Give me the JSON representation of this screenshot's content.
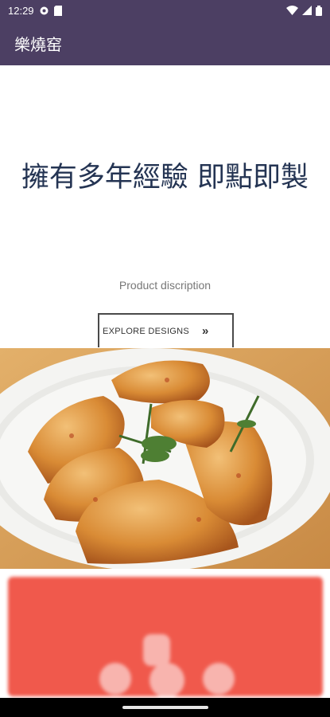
{
  "status_bar": {
    "time": "12:29",
    "icons": [
      "gear-icon",
      "sim-card-icon",
      "wifi-icon",
      "signal-icon",
      "battery-icon"
    ]
  },
  "app_bar": {
    "title": "樂燒窑"
  },
  "hero": {
    "title": "擁有多年經驗 即點即製",
    "description": "Product discription"
  },
  "explore_button": {
    "label": "EXPLORE DESIGNS",
    "icon": "double-chevron-right-icon"
  },
  "food_image": {
    "subject": "roasted chicken wings on white plate with rosemary"
  },
  "colors": {
    "app_bar": "#4c3f63",
    "title_text": "#243453",
    "promo_banner": "#f0594c"
  }
}
